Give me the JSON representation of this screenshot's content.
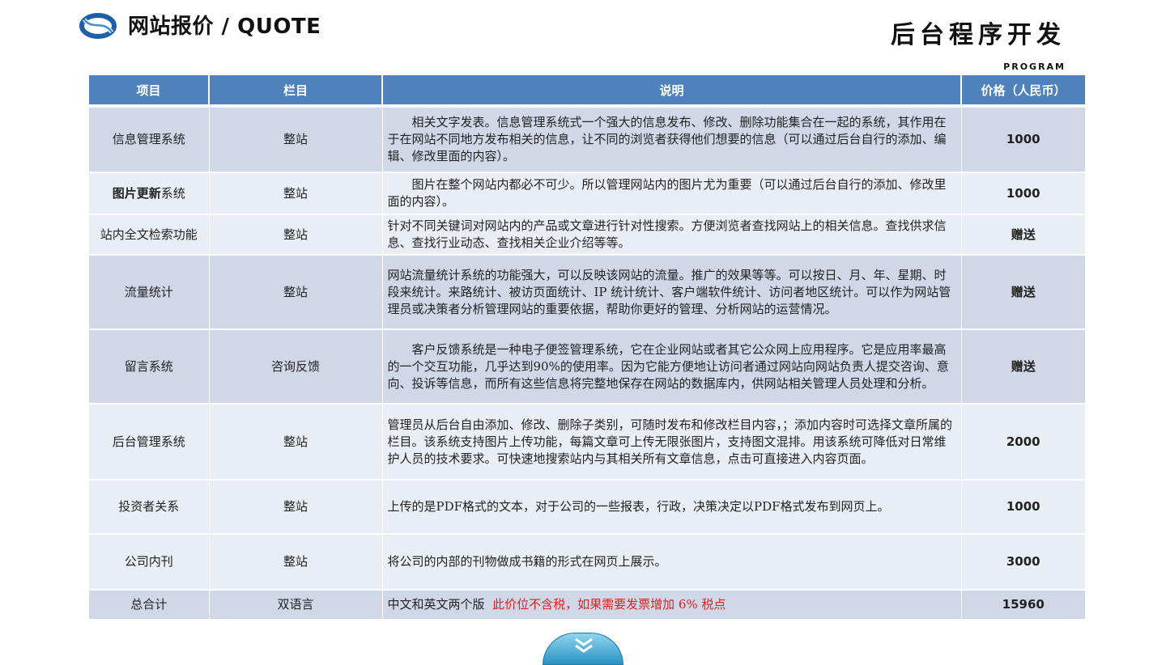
{
  "header": {
    "title": "网站报价 / QUOTE",
    "title_cn": "后台程序开发",
    "title_en": "PROGRAM",
    "logo_icon": "swirl-logo-icon"
  },
  "table": {
    "columns": [
      "项目",
      "栏目",
      "说明",
      "价格（人民币）"
    ],
    "rows": [
      {
        "item": "信息管理系统",
        "column": "整站",
        "desc": "相关文字发表。信息管理系统式一个强大的信息发布、修改、删除功能集合在一起的系统，其作用在于在网站不同地方发布相关的信息，让不同的浏览者获得他们想要的信息（可以通过后台自行的添加、编辑、修改里面的内容）。",
        "price": "1000"
      },
      {
        "item_bold": "图片更新",
        "item_rest": "系统",
        "column": "整站",
        "desc": "图片在整个网站内都必不可少。所以管理网站内的图片尤为重要（可以通过后台自行的添加、修改里面的内容）。",
        "price": "1000"
      },
      {
        "item": "站内全文检索功能",
        "column": "整站",
        "desc": "针对不同关键词对网站内的产品或文章进行针对性搜索。方便浏览者查找网站上的相关信息。查找供求信息、查找行业动态、查找相关企业介绍等等。",
        "price": "赠送"
      },
      {
        "item": "流量统计",
        "column": "整站",
        "desc": "网站流量统计系统的功能强大，可以反映该网站的流量。推广的效果等等。可以按日、月、年、星期、时段来统计。来路统计、被访页面统计、IP 统计统计、客户端软件统计、访问者地区统计。可以作为网站管理员或决策者分析管理网站的重要依据，帮助你更好的管理、分析网站的运营情况。",
        "price": "赠送"
      },
      {
        "item": "留言系统",
        "column": "咨询反馈",
        "desc": "客户反馈系统是一种电子便签管理系统，它在企业网站或者其它公众网上应用程序。它是应用率最高的一个交互功能，几乎达到90%的使用率。因为它能方便地让访问者通过网站向网站负责人提交咨询、意向、投诉等信息，而所有这些信息将完整地保存在网站的数据库内，供网站相关管理人员处理和分析。",
        "price": "赠送"
      },
      {
        "item": "后台管理系统",
        "column": "整站",
        "desc": "管理员从后台自由添加、修改、删除子类别，可随时发布和修改栏目内容，；添加内容时可选择文章所属的栏目。该系统支持图片上传功能，每篇文章可上传无限张图片，支持图文混排。用该系统可降低对日常维护人员的技术要求。可快速地搜索站内与其相关所有文章信息，点击可直接进入内容页面。",
        "price": "2000"
      },
      {
        "item": "投资者关系",
        "column": "整站",
        "desc": "上传的是PDF格式的文本，对于公司的一些报表，行政，决策决定以PDF格式发布到网页上。",
        "price": "1000"
      },
      {
        "item": "公司内刊",
        "column": "整站",
        "desc": "将公司的内部的刊物做成书籍的形式在网页上展示。",
        "price": "3000"
      },
      {
        "item": "总合计",
        "column": "双语言",
        "desc": "中文和英文两个版",
        "desc_note": "此价位不含税，如果需要发票增加 6% 税点",
        "price": "15960"
      }
    ]
  },
  "footer": {
    "nav_icon": "double-chevron-down-icon"
  },
  "colors": {
    "header_bg": "#4f81bd",
    "row_dark": "#d0d8e8",
    "row_light": "#e9edf4",
    "price_red": "#d91c1c"
  }
}
